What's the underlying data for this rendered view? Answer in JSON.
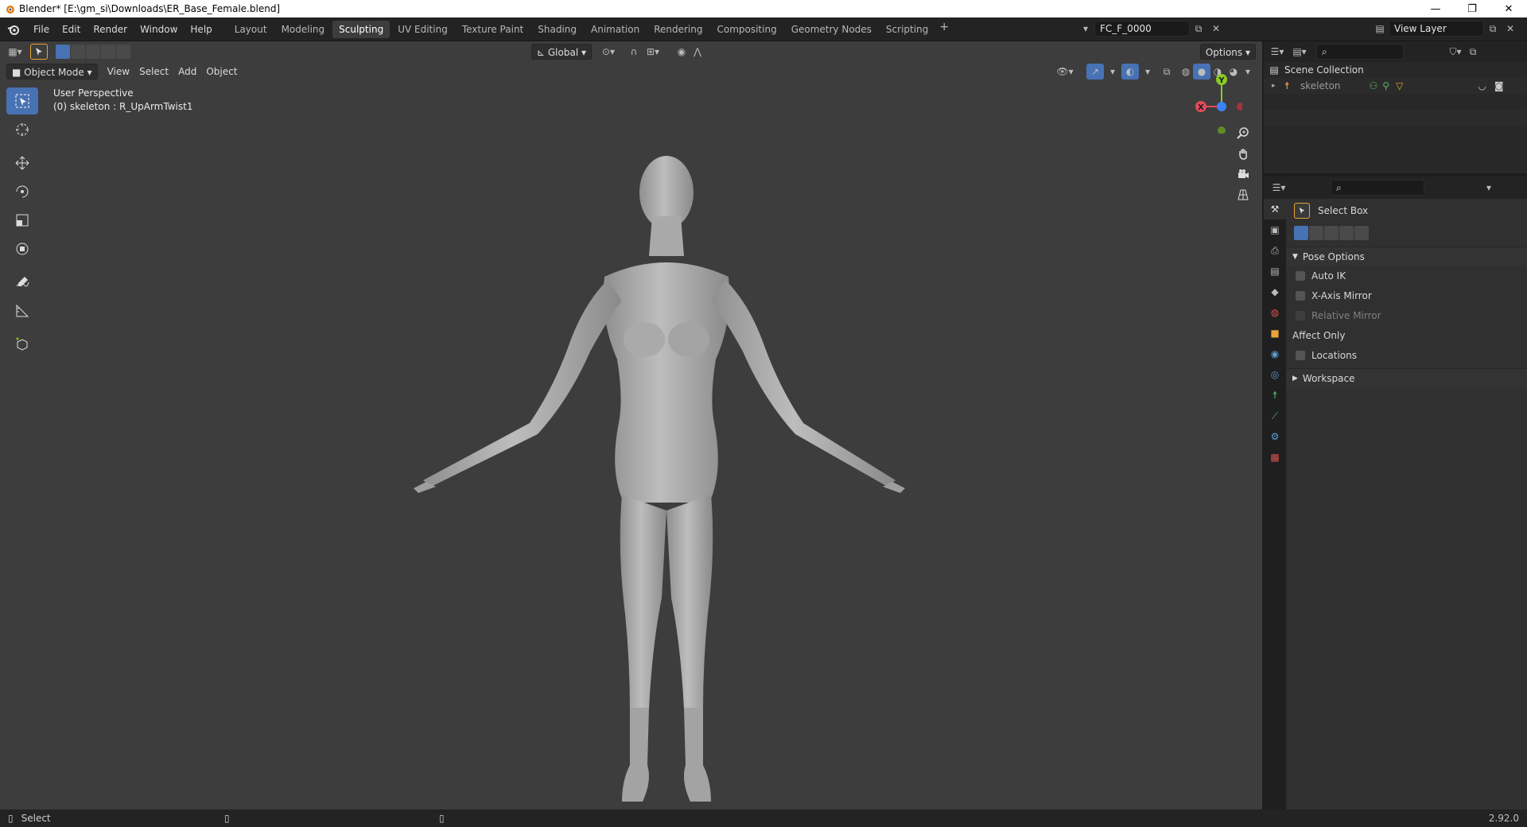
{
  "window": {
    "title": "Blender* [E:\\gm_si\\Downloads\\ER_Base_Female.blend]",
    "min": "—",
    "restore": "❐",
    "close": "✕"
  },
  "menu": [
    "File",
    "Edit",
    "Render",
    "Window",
    "Help"
  ],
  "workspaces": [
    {
      "label": "Layout",
      "active": false
    },
    {
      "label": "Modeling",
      "active": false
    },
    {
      "label": "Sculpting",
      "active": true
    },
    {
      "label": "UV Editing",
      "active": false
    },
    {
      "label": "Texture Paint",
      "active": false
    },
    {
      "label": "Shading",
      "active": false
    },
    {
      "label": "Animation",
      "active": false
    },
    {
      "label": "Rendering",
      "active": false
    },
    {
      "label": "Compositing",
      "active": false
    },
    {
      "label": "Geometry Nodes",
      "active": false
    },
    {
      "label": "Scripting",
      "active": false
    }
  ],
  "workspace_add": "+",
  "scene": {
    "name": "FC_F_0000"
  },
  "view_layer": {
    "name": "View Layer"
  },
  "viewport": {
    "orientation": "Global",
    "options_label": "Options",
    "mode": "Object Mode",
    "header_menus": [
      "View",
      "Select",
      "Add",
      "Object"
    ],
    "perspective_text": "User Perspective",
    "object_text": "(0) skeleton : R_UpArmTwist1",
    "gizmo": {
      "x": "X",
      "y": "Y"
    }
  },
  "outliner": {
    "collection": "Scene Collection",
    "items": [
      {
        "label": "skeleton"
      }
    ]
  },
  "properties": {
    "tool_name": "Select Box",
    "pose_options": {
      "title": "Pose Options",
      "auto_ik": "Auto IK",
      "x_mirror": "X-Axis Mirror",
      "relative_mirror": "Relative Mirror",
      "affect_only": "Affect Only",
      "locations": "Locations"
    },
    "workspace_panel": "Workspace"
  },
  "statusbar": {
    "select_label": "Select",
    "version": "2.92.0"
  },
  "colors": {
    "accent": "#4772b3",
    "viewport_bg": "#3d3d3d",
    "axis_x": "#e64a5a",
    "axis_y": "#8ac926",
    "axis_z": "#3b82f6"
  }
}
